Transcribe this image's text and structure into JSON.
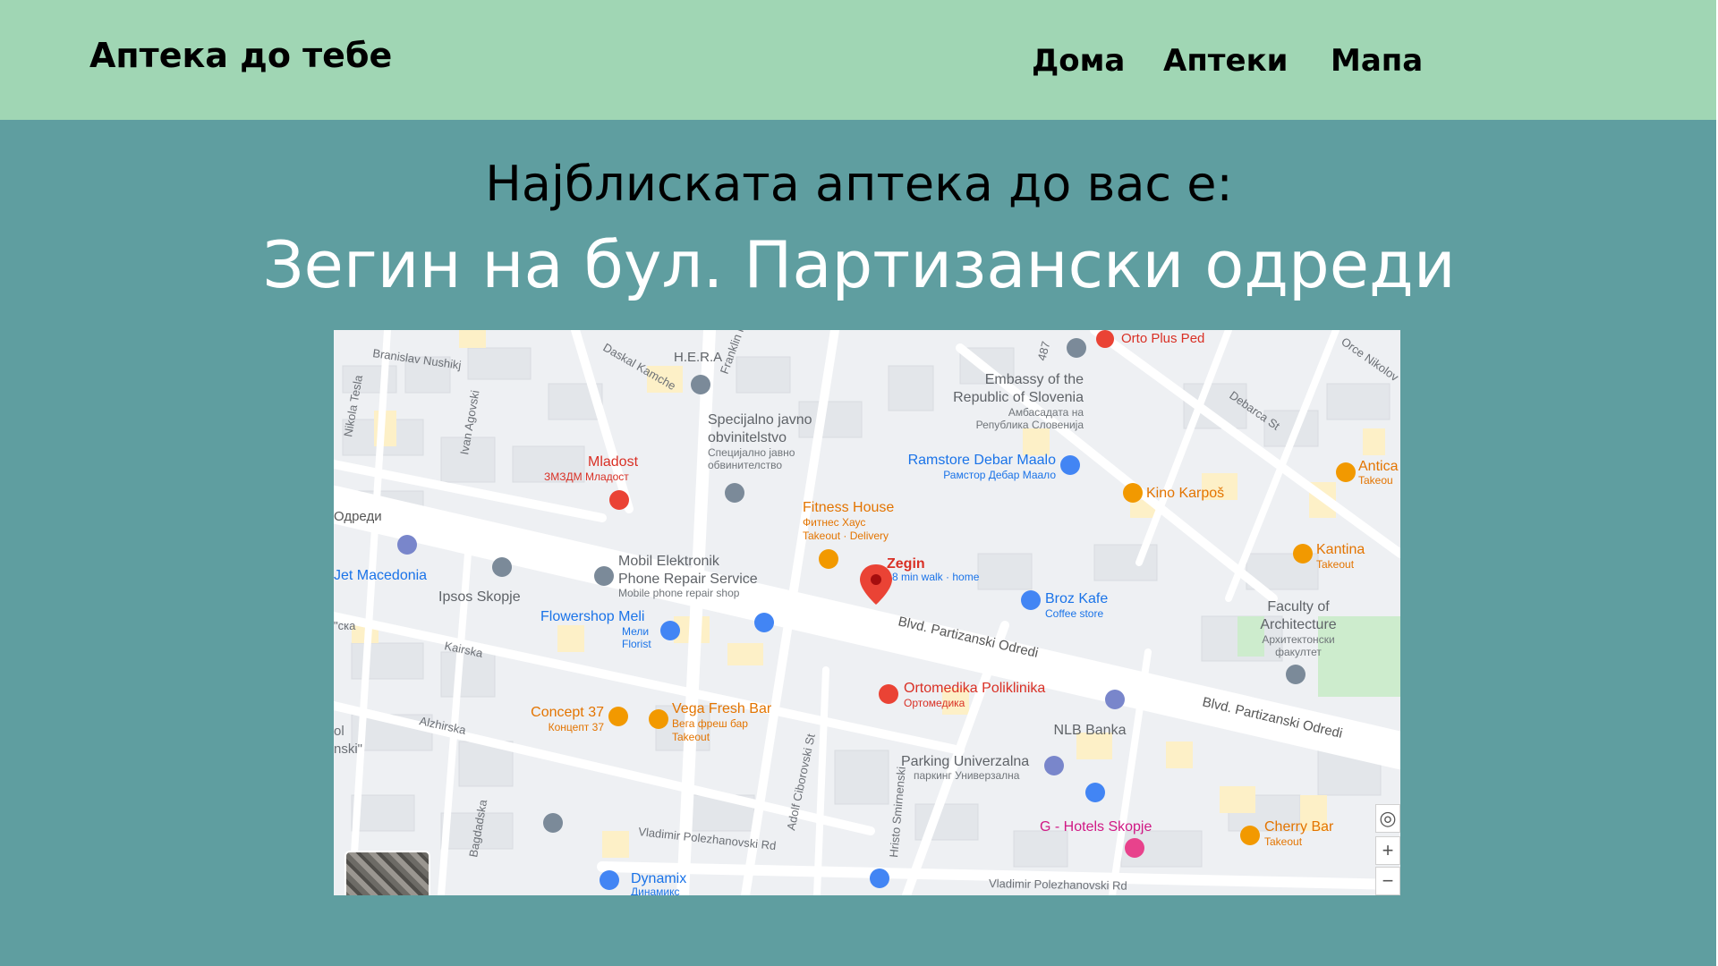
{
  "header": {
    "brand": "Аптека до тебе",
    "nav": [
      "Дома",
      "Аптеки",
      "Мапа"
    ]
  },
  "main": {
    "subtitle": "Најблиската аптека до вас е:",
    "pharmacy": "Зегин на бул. Партизански одреди"
  },
  "map": {
    "street_labels": [
      "Branislav Nushikj",
      "Daskal Kamche",
      "Franklin R",
      "Nikola Tesla",
      "Ivan Agovski",
      "Blvd. Partizanski Odredi",
      "Blvd. Partizanski Odredi",
      "Kairska",
      "Alzhirska",
      "Adolf Ciborovski St",
      "Hristo Smirnenski",
      "Bagdadska",
      "Vladimir Polezhanovski Rd",
      "Vladimir Polezhanovski Rd",
      "Debarca St",
      "Orce Nikolov",
      "487",
      "Одреди",
      "\"ска",
      "ol",
      "nski\""
    ],
    "places": [
      {
        "name": "Zegin",
        "sub": "8 min walk · home",
        "color": "#d93025"
      },
      {
        "name": "Orto Plus Ped",
        "sub": "",
        "color": "#d93025"
      },
      {
        "name": "H.E.R.A",
        "sub": "",
        "color": "#5f6368"
      },
      {
        "name": "Embassy of the",
        "sub": "Republic of Slovenia",
        "color": "#5f6368"
      },
      {
        "name": "Амбасадата на",
        "sub": "Република Словенија",
        "color": "#5f6368"
      },
      {
        "name": "Specijalno javno",
        "sub": "obvinitelstvo",
        "color": "#5f6368"
      },
      {
        "name": "Специјално јавно",
        "sub": "обвинителство",
        "color": "#5f6368"
      },
      {
        "name": "Mladost",
        "sub": "ЗМЗДМ Младост",
        "color": "#d93025"
      },
      {
        "name": "Ramstore Debar Maalo",
        "sub": "Рамстор Дебар Маало",
        "color": "#1a73e8"
      },
      {
        "name": "Kino Karpoš",
        "sub": "",
        "color": "#e37400"
      },
      {
        "name": "Antica",
        "sub": "Takeou",
        "color": "#e37400"
      },
      {
        "name": "Fitness House",
        "sub": "Фитнес Хаус",
        "color": "#e37400"
      },
      {
        "name": "Takeout · Delivery",
        "sub": "",
        "color": "#e37400"
      },
      {
        "name": "Kantina",
        "sub": "Takeout",
        "color": "#e37400"
      },
      {
        "name": "Jet Macedonia",
        "sub": "",
        "color": "#1a73e8"
      },
      {
        "name": "Ipsos Skopje",
        "sub": "",
        "color": "#5f6368"
      },
      {
        "name": "Mobil Elektronik",
        "sub": "Phone Repair Service",
        "color": "#5f6368"
      },
      {
        "name": "Mobile phone repair shop",
        "sub": "",
        "color": "#5f6368"
      },
      {
        "name": "Broz Kafe",
        "sub": "Coffee store",
        "color": "#1a73e8"
      },
      {
        "name": "Faculty of",
        "sub": "Architecture",
        "color": "#5f6368"
      },
      {
        "name": "Архитектонски",
        "sub": "факултет",
        "color": "#5f6368"
      },
      {
        "name": "Flowershop Meli",
        "sub": "Мели",
        "color": "#1a73e8"
      },
      {
        "name": "Florist",
        "sub": "",
        "color": "#1a73e8"
      },
      {
        "name": "Ortomedika Poliklinika",
        "sub": "Ортомедика",
        "color": "#d93025"
      },
      {
        "name": "Concept 37",
        "sub": "Концепт 37",
        "color": "#e37400"
      },
      {
        "name": "Vega Fresh Bar",
        "sub": "Вега фреш бар",
        "color": "#e37400"
      },
      {
        "name": "Takeout",
        "sub": "",
        "color": "#e37400"
      },
      {
        "name": "NLB Banka",
        "sub": "",
        "color": "#5f6368"
      },
      {
        "name": "Parking Univerzalna",
        "sub": "паркинг Универзална",
        "color": "#5f6368"
      },
      {
        "name": "G - Hotels Skopje",
        "sub": "",
        "color": "#d01884"
      },
      {
        "name": "Cherry Bar",
        "sub": "Takeout",
        "color": "#e37400"
      },
      {
        "name": "Dynamix",
        "sub": "Динамикс",
        "color": "#1a73e8"
      }
    ],
    "controls": {
      "locate": "◎",
      "zoom_in": "+",
      "zoom_out": "−"
    }
  }
}
